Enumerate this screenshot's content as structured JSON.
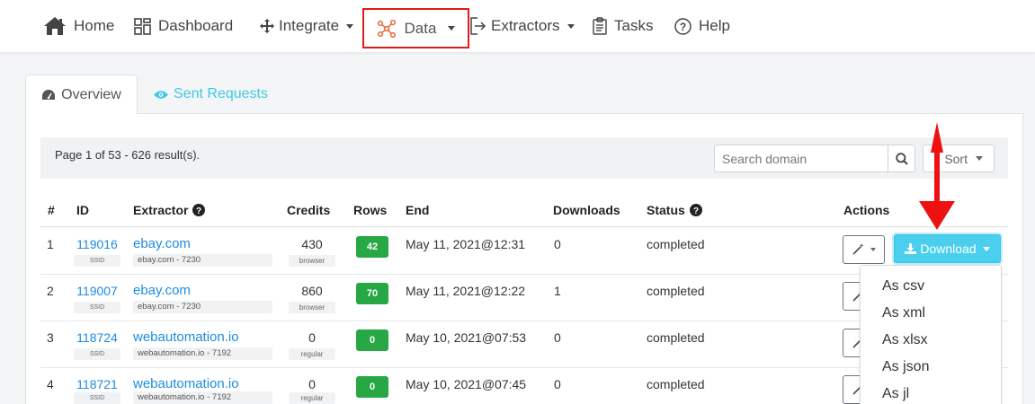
{
  "nav": {
    "home": "Home",
    "dashboard": "Dashboard",
    "integrate": "Integrate",
    "data": "Data",
    "extractors": "Extractors",
    "tasks": "Tasks",
    "help": "Help"
  },
  "tabs": {
    "overview": "Overview",
    "sent_requests": "Sent Requests"
  },
  "toolbar": {
    "page_info": "Page 1 of 53 - 626 result(s).",
    "search_placeholder": "Search domain",
    "sort_label": "Sort"
  },
  "table": {
    "headers": {
      "num": "#",
      "id": "ID",
      "extractor": "Extractor",
      "credits": "Credits",
      "rows": "Rows",
      "end": "End",
      "downloads": "Downloads",
      "status": "Status",
      "actions": "Actions"
    },
    "rows": [
      {
        "num": "1",
        "id": "119016",
        "ssid": "SSID",
        "extractor": "ebay.com",
        "extractor_sub": "ebay.com - 7230",
        "credits": "430",
        "credits_sub": "browser",
        "rows": "42",
        "end": "May 11, 2021@12:31",
        "downloads": "0",
        "status": "completed"
      },
      {
        "num": "2",
        "id": "119007",
        "ssid": "SSID",
        "extractor": "ebay.com",
        "extractor_sub": "ebay.com - 7230",
        "credits": "860",
        "credits_sub": "browser",
        "rows": "70",
        "end": "May 11, 2021@12:22",
        "downloads": "1",
        "status": "completed"
      },
      {
        "num": "3",
        "id": "118724",
        "ssid": "SSID",
        "extractor": "webautomation.io",
        "extractor_sub": "webautomation.io - 7192",
        "credits": "0",
        "credits_sub": "regular",
        "rows": "0",
        "end": "May 10, 2021@07:53",
        "downloads": "0",
        "status": "completed"
      },
      {
        "num": "4",
        "id": "118721",
        "ssid": "SSID",
        "extractor": "webautomation.io",
        "extractor_sub": "webautomation.io - 7192",
        "credits": "0",
        "credits_sub": "regular",
        "rows": "0",
        "end": "May 10, 2021@07:45",
        "downloads": "0",
        "status": "completed"
      }
    ]
  },
  "download": {
    "label": "Download",
    "options": [
      "As csv",
      "As xml",
      "As xlsx",
      "As json",
      "As jl"
    ]
  },
  "colors": {
    "accent": "#4ad0ee",
    "link": "#1d8ce0",
    "badge_green": "#28a745",
    "highlight_red": "#e01b1b"
  }
}
